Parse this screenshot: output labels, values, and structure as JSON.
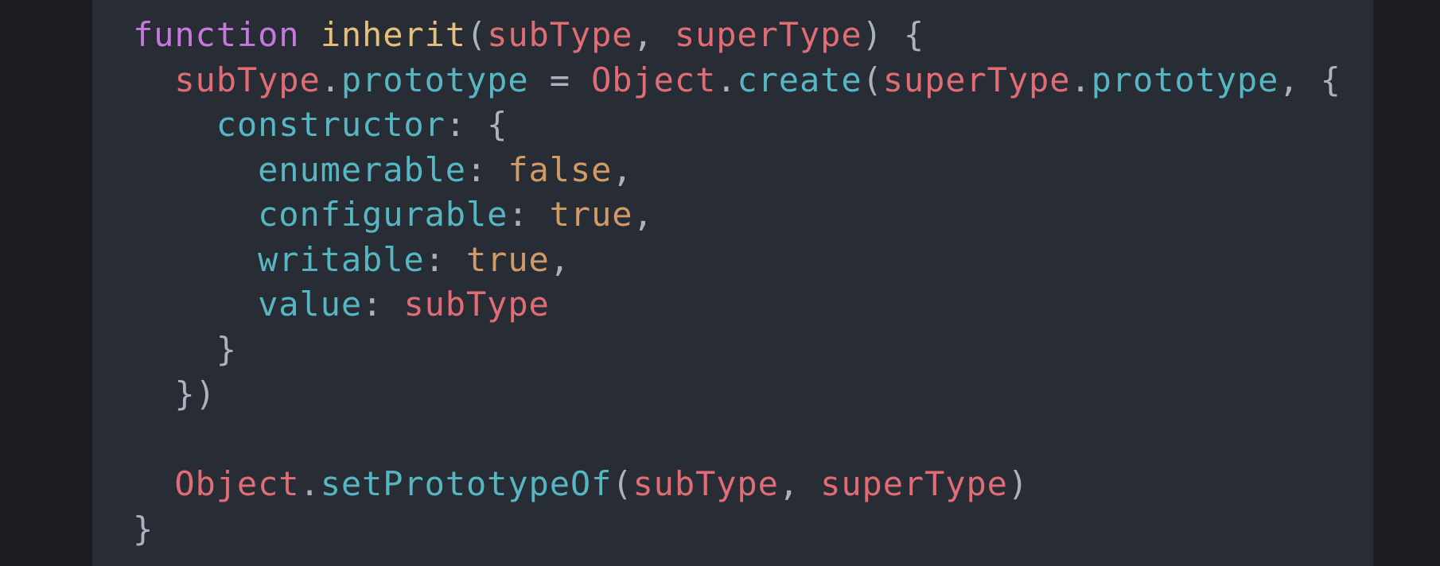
{
  "colors": {
    "background": "#1c1d20",
    "editor_background": "#282c34",
    "keyword": "#c678dd",
    "function_name": "#e5c07b",
    "parameter": "#e06c75",
    "property": "#56b6c2",
    "boolean": "#d19a66",
    "punctuation": "#abb2bf"
  },
  "code": {
    "lines": [
      [
        {
          "t": "keyword",
          "v": "function"
        },
        {
          "t": "punct",
          "v": " "
        },
        {
          "t": "fn",
          "v": "inherit"
        },
        {
          "t": "punct",
          "v": "("
        },
        {
          "t": "param",
          "v": "subType"
        },
        {
          "t": "punct",
          "v": ", "
        },
        {
          "t": "param",
          "v": "superType"
        },
        {
          "t": "punct",
          "v": ") {"
        }
      ],
      [
        {
          "t": "punct",
          "v": "  "
        },
        {
          "t": "var",
          "v": "subType"
        },
        {
          "t": "punct",
          "v": "."
        },
        {
          "t": "prop",
          "v": "prototype"
        },
        {
          "t": "punct",
          "v": " = "
        },
        {
          "t": "obj",
          "v": "Object"
        },
        {
          "t": "punct",
          "v": "."
        },
        {
          "t": "prop",
          "v": "create"
        },
        {
          "t": "punct",
          "v": "("
        },
        {
          "t": "var",
          "v": "superType"
        },
        {
          "t": "punct",
          "v": "."
        },
        {
          "t": "prop",
          "v": "prototype"
        },
        {
          "t": "punct",
          "v": ", {"
        }
      ],
      [
        {
          "t": "punct",
          "v": "    "
        },
        {
          "t": "prop",
          "v": "constructor"
        },
        {
          "t": "punct",
          "v": ": {"
        }
      ],
      [
        {
          "t": "punct",
          "v": "      "
        },
        {
          "t": "prop",
          "v": "enumerable"
        },
        {
          "t": "punct",
          "v": ": "
        },
        {
          "t": "bool",
          "v": "false"
        },
        {
          "t": "punct",
          "v": ","
        }
      ],
      [
        {
          "t": "punct",
          "v": "      "
        },
        {
          "t": "prop",
          "v": "configurable"
        },
        {
          "t": "punct",
          "v": ": "
        },
        {
          "t": "bool",
          "v": "true"
        },
        {
          "t": "punct",
          "v": ","
        }
      ],
      [
        {
          "t": "punct",
          "v": "      "
        },
        {
          "t": "prop",
          "v": "writable"
        },
        {
          "t": "punct",
          "v": ": "
        },
        {
          "t": "bool",
          "v": "true"
        },
        {
          "t": "punct",
          "v": ","
        }
      ],
      [
        {
          "t": "punct",
          "v": "      "
        },
        {
          "t": "prop",
          "v": "value"
        },
        {
          "t": "punct",
          "v": ": "
        },
        {
          "t": "var",
          "v": "subType"
        }
      ],
      [
        {
          "t": "punct",
          "v": "    }"
        }
      ],
      [
        {
          "t": "punct",
          "v": "  })"
        }
      ],
      [],
      [
        {
          "t": "punct",
          "v": "  "
        },
        {
          "t": "obj",
          "v": "Object"
        },
        {
          "t": "punct",
          "v": "."
        },
        {
          "t": "prop",
          "v": "setPrototypeOf"
        },
        {
          "t": "punct",
          "v": "("
        },
        {
          "t": "var",
          "v": "subType"
        },
        {
          "t": "punct",
          "v": ", "
        },
        {
          "t": "var",
          "v": "superType"
        },
        {
          "t": "punct",
          "v": ")"
        }
      ],
      [
        {
          "t": "punct",
          "v": "}"
        }
      ]
    ]
  }
}
